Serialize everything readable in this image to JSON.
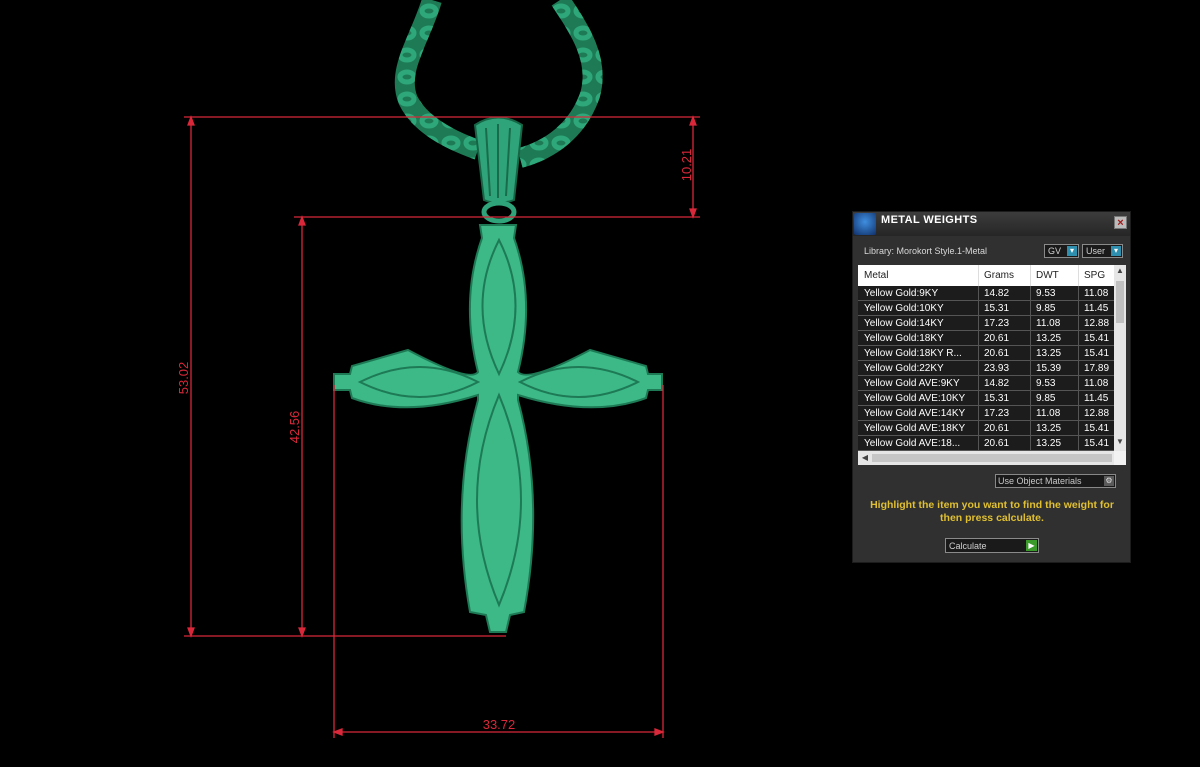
{
  "dimensions": {
    "overall_height": "53.02",
    "bail_height": "10.21",
    "cross_height": "42.56",
    "cross_width": "33.72"
  },
  "colors": {
    "model": "#3db887",
    "model_dark": "#1d7a55",
    "dimension_line": "#d8283a",
    "instruction_text": "#e0c030"
  },
  "panel": {
    "title": "METAL WEIGHTS",
    "close_icon": "close-icon",
    "library_label": "Library: Morokort Style.1-Metal",
    "unit_dropdown": "GV",
    "user_dropdown": "User",
    "columns": [
      "Metal",
      "Grams",
      "DWT",
      "SPG"
    ],
    "rows": [
      {
        "metal": "Yellow Gold:9KY",
        "grams": "14.82",
        "dwt": "9.53",
        "spg": "11.08"
      },
      {
        "metal": "Yellow Gold:10KY",
        "grams": "15.31",
        "dwt": "9.85",
        "spg": "11.45"
      },
      {
        "metal": "Yellow Gold:14KY",
        "grams": "17.23",
        "dwt": "11.08",
        "spg": "12.88"
      },
      {
        "metal": "Yellow Gold:18KY",
        "grams": "20.61",
        "dwt": "13.25",
        "spg": "15.41"
      },
      {
        "metal": "Yellow Gold:18KY R...",
        "grams": "20.61",
        "dwt": "13.25",
        "spg": "15.41"
      },
      {
        "metal": "Yellow Gold:22KY",
        "grams": "23.93",
        "dwt": "15.39",
        "spg": "17.89"
      },
      {
        "metal": "Yellow Gold AVE:9KY",
        "grams": "14.82",
        "dwt": "9.53",
        "spg": "11.08"
      },
      {
        "metal": "Yellow Gold AVE:10KY",
        "grams": "15.31",
        "dwt": "9.85",
        "spg": "11.45"
      },
      {
        "metal": "Yellow Gold AVE:14KY",
        "grams": "17.23",
        "dwt": "11.08",
        "spg": "12.88"
      },
      {
        "metal": "Yellow Gold AVE:18KY",
        "grams": "20.61",
        "dwt": "13.25",
        "spg": "15.41"
      },
      {
        "metal": "Yellow Gold AVE:18...",
        "grams": "20.61",
        "dwt": "13.25",
        "spg": "15.41"
      }
    ],
    "materials_dropdown": "Use Object Materials",
    "instructions": "Highlight the item you want to find the weight for then press calculate.",
    "calculate_label": "Calculate"
  }
}
